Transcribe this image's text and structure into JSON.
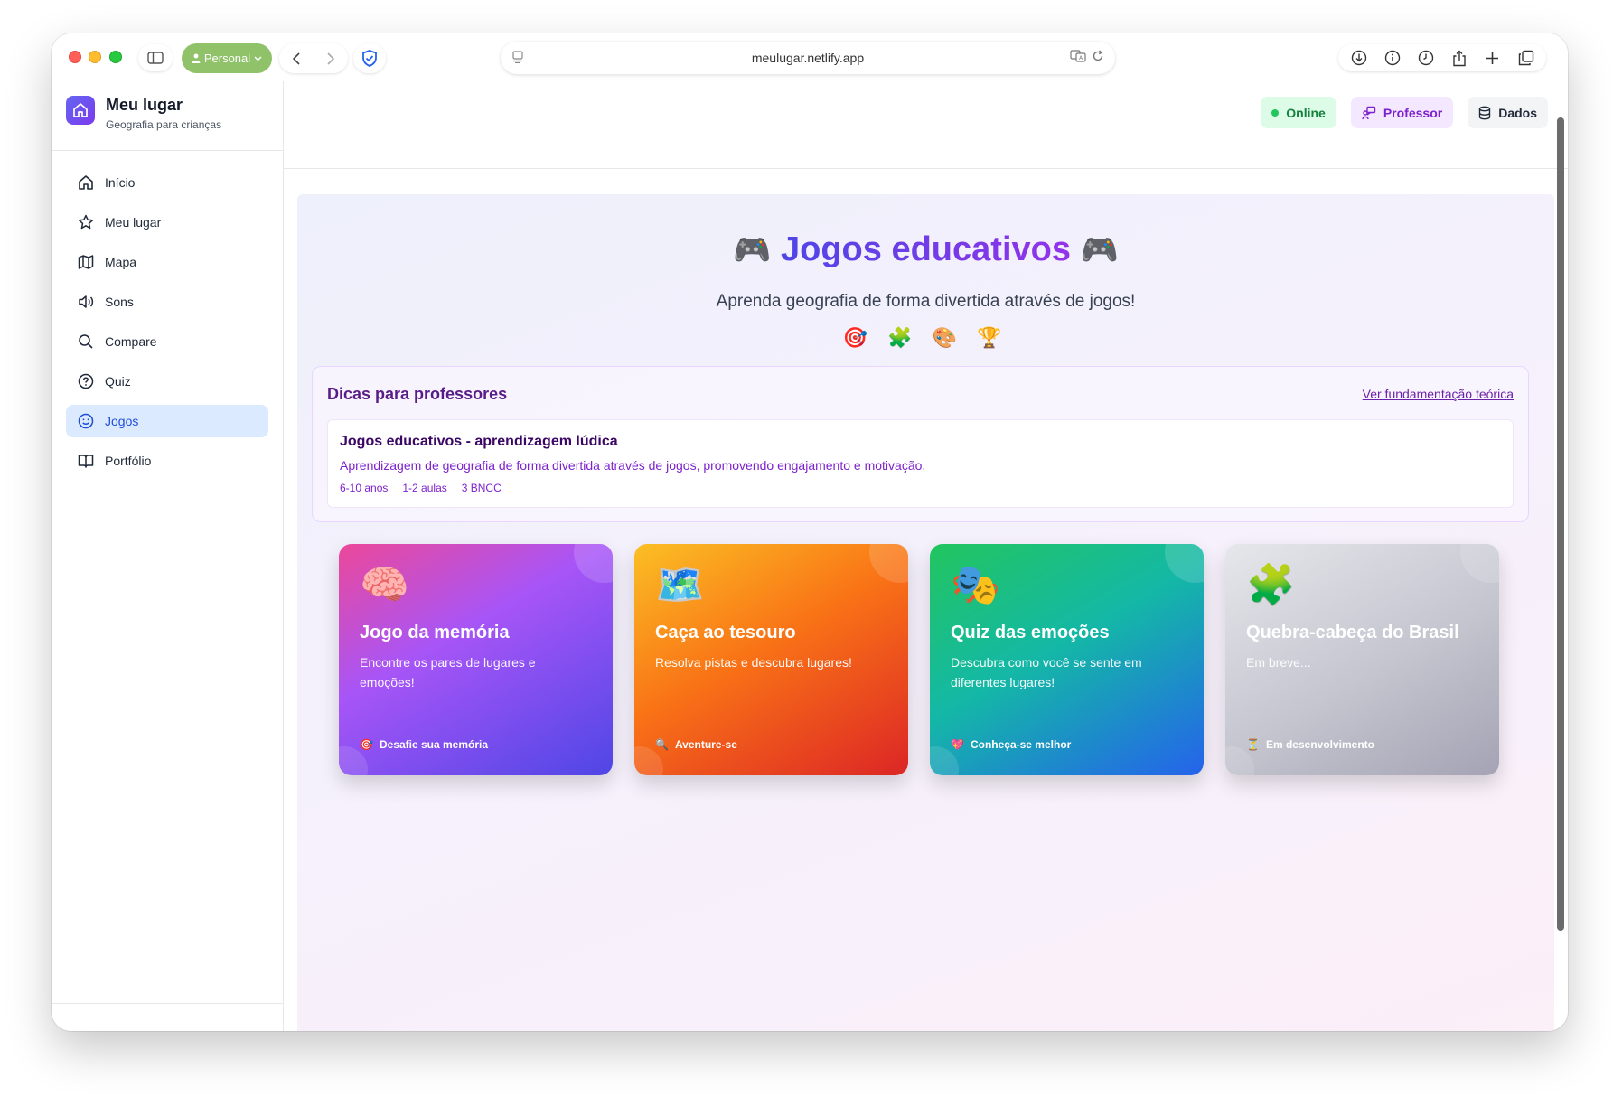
{
  "browser": {
    "profile_label": "Personal",
    "url": "meulugar.netlify.app"
  },
  "brand": {
    "title": "Meu lugar",
    "subtitle": "Geografia para crianças"
  },
  "sidebar": {
    "items": [
      {
        "label": "Início",
        "icon": "home-icon"
      },
      {
        "label": "Meu lugar",
        "icon": "star-icon"
      },
      {
        "label": "Mapa",
        "icon": "map-icon"
      },
      {
        "label": "Sons",
        "icon": "speaker-icon"
      },
      {
        "label": "Compare",
        "icon": "search-icon"
      },
      {
        "label": "Quiz",
        "icon": "help-circle-icon"
      },
      {
        "label": "Jogos",
        "icon": "smile-icon",
        "active": true
      },
      {
        "label": "Portfólio",
        "icon": "book-icon"
      }
    ]
  },
  "topbar": {
    "online": "Online",
    "professor": "Professor",
    "dados": "Dados"
  },
  "hero": {
    "emoji_left": "🎮",
    "title": "Jogos educativos",
    "emoji_right": "🎮",
    "subtitle": "Aprenda geografia de forma divertida através de jogos!",
    "icons": "🎯 🧩 🎨 🏆"
  },
  "tips": {
    "title": "Dicas para professores",
    "link": "Ver fundamentação teórica",
    "card": {
      "title": "Jogos educativos - aprendizagem lúdica",
      "description": "Aprendizagem de geografia de forma divertida através de jogos, promovendo engajamento e motivação.",
      "age": "6-10 anos",
      "duration": "1-2 aulas",
      "bncc": "3 BNCC"
    }
  },
  "games": [
    {
      "icon": "🧠",
      "title": "Jogo da memória",
      "description": "Encontre os pares de lugares e emoções!",
      "foot_icon": "🎯",
      "foot": "Desafie sua memória"
    },
    {
      "icon": "🗺️",
      "title": "Caça ao tesouro",
      "description": "Resolva pistas e descubra lugares!",
      "foot_icon": "🔍",
      "foot": "Aventure-se"
    },
    {
      "icon": "🎭",
      "title": "Quiz das emoções",
      "description": "Descubra como você se sente em diferentes lugares!",
      "foot_icon": "💖",
      "foot": "Conheça-se melhor"
    },
    {
      "icon": "🧩",
      "title": "Quebra-cabeça do Brasil",
      "description": "Em breve...",
      "foot_icon": "⏳",
      "foot": "Em desenvolvimento"
    }
  ],
  "colors": {
    "accent_indigo": "#4f46e5",
    "accent_purple": "#9333ea",
    "active_nav_bg": "#dbeafe",
    "online_green": "#22c55e"
  }
}
